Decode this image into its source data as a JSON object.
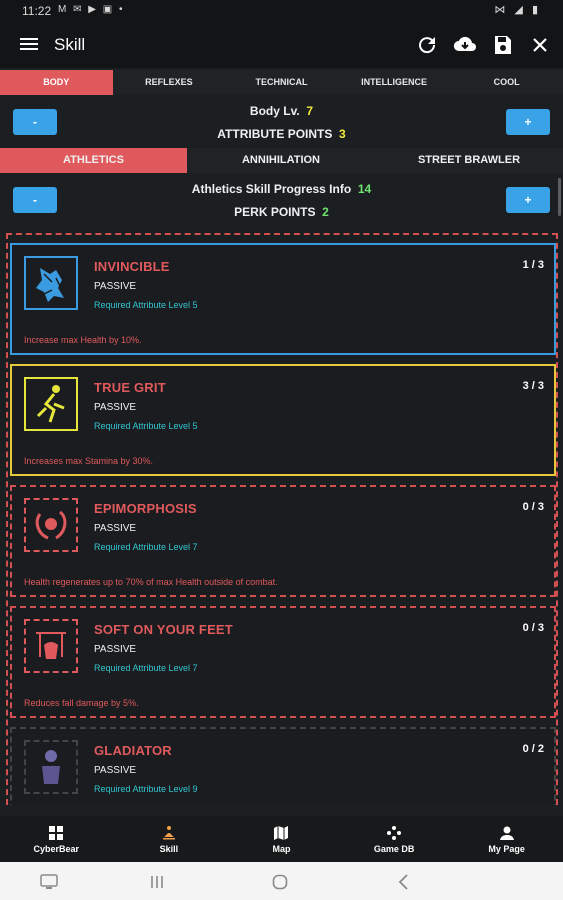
{
  "status": {
    "time": "11:22",
    "left_icons": "M ✉ ▶ ▣ •",
    "right_icons": "⋈ ◢ ▮"
  },
  "app": {
    "title": "Skill"
  },
  "attribute_tabs": [
    {
      "label": "BODY",
      "active": true
    },
    {
      "label": "REFLEXES",
      "active": false
    },
    {
      "label": "TECHNICAL",
      "active": false
    },
    {
      "label": "INTELLIGENCE",
      "active": false
    },
    {
      "label": "COOL",
      "active": false
    }
  ],
  "attribute": {
    "level_label": "Body Lv.",
    "level_value": "7",
    "points_label": "ATTRIBUTE POINTS",
    "points_value": "3",
    "minus": "-",
    "plus": "+"
  },
  "skill_tabs": [
    {
      "label": "ATHLETICS",
      "active": true
    },
    {
      "label": "ANNIHILATION",
      "active": false
    },
    {
      "label": "STREET BRAWLER",
      "active": false
    }
  ],
  "skill": {
    "progress_label": "Athletics Skill Progress Info",
    "progress_value": "14",
    "perk_label": "PERK POINTS",
    "perk_value": "2",
    "minus": "-",
    "plus": "+"
  },
  "perks": [
    {
      "name": "INVINCIBLE",
      "type": "PASSIVE",
      "req": "Required Attribute Level 5",
      "rank": "1 / 3",
      "desc": "Increase max Health by 10%.",
      "border": "#3a9be0",
      "icon_color": "#3a9be0",
      "desc_color": "#e05a5d",
      "icon": "invincible-icon"
    },
    {
      "name": "TRUE GRIT",
      "type": "PASSIVE",
      "req": "Required Attribute Level 5",
      "rank": "3 / 3",
      "desc": "Increases max Stamina by 30%.",
      "border": "#e6c93a",
      "icon_color": "#e6e63a",
      "desc_color": "#e05a5d",
      "icon": "true-grit-icon"
    },
    {
      "name": "EPIMORPHOSIS",
      "type": "PASSIVE",
      "req": "Required Attribute Level 7",
      "rank": "0 / 3",
      "desc": "Health regenerates up to 70% of max Health outside of combat.",
      "border": "#d35052",
      "icon_color": "#e05a5d",
      "desc_color": "#e05a5d",
      "icon": "epimorphosis-icon"
    },
    {
      "name": "SOFT ON YOUR FEET",
      "type": "PASSIVE",
      "req": "Required Attribute Level 7",
      "rank": "0 / 3",
      "desc": "Reduces fall damage by 5%.",
      "border": "#d35052",
      "icon_color": "#e05a5d",
      "desc_color": "#e05a5d",
      "icon": "soft-feet-icon"
    },
    {
      "name": "GLADIATOR",
      "type": "PASSIVE",
      "req": "Required Attribute Level 9",
      "rank": "0 / 2",
      "desc": "",
      "border": "#444",
      "icon_color": "#6f6aa8",
      "desc_color": "#e05a5d",
      "icon": "gladiator-icon"
    }
  ],
  "bottom_nav": [
    {
      "label": "CyberBear",
      "icon": "grid-icon",
      "color": "#ffffff"
    },
    {
      "label": "Skill",
      "icon": "meditation-icon",
      "color": "#ffffff"
    },
    {
      "label": "Map",
      "icon": "map-icon",
      "color": "#ffffff"
    },
    {
      "label": "Game DB",
      "icon": "gamepad-icon",
      "color": "#ffffff"
    },
    {
      "label": "My Page",
      "icon": "person-icon",
      "color": "#ffffff"
    }
  ],
  "colors": {
    "accent_red": "#e05a5d",
    "accent_blue": "#3aa3e8",
    "yellow": "#f5e93b",
    "green": "#6fe36f",
    "cyan": "#33c6d1"
  }
}
